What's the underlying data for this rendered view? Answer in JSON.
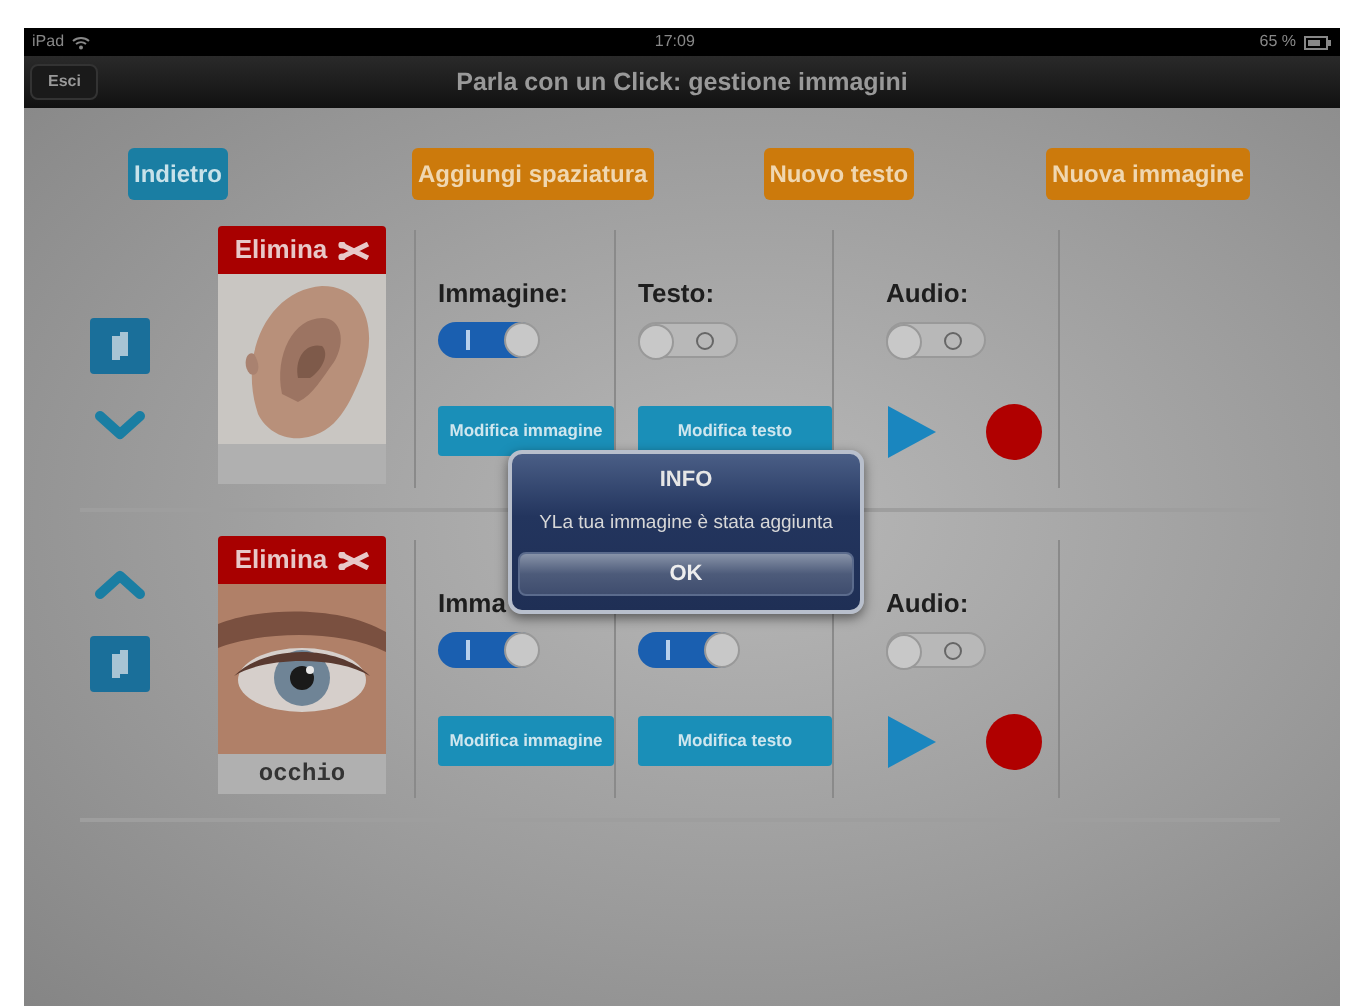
{
  "status_bar": {
    "device": "iPad",
    "time": "17:09",
    "battery": "65 %"
  },
  "nav_bar": {
    "back_button": "Esci",
    "title": "Parla con un Click: gestione immagini"
  },
  "toolbar": [
    {
      "label": "Indietro",
      "kind": "blue"
    },
    {
      "label": "Aggiungi spaziatura",
      "kind": "orange"
    },
    {
      "label": "Nuovo testo",
      "kind": "orange"
    },
    {
      "label": "Nuova immagine",
      "kind": "orange"
    }
  ],
  "items": [
    {
      "controls": [
        {
          "kind": "copy"
        },
        {
          "kind": "down"
        }
      ],
      "delete_label": "Elimina",
      "image_toggle": {
        "label": "Immagine:",
        "on": true
      },
      "image_button": "Modifica immagine",
      "text_toggle": {
        "label": "Testo:",
        "on": false
      },
      "text_button": "Modifica testo",
      "audio_toggle": {
        "label": "Audio:",
        "on": false
      }
    },
    {
      "controls": [
        {
          "kind": "up"
        },
        {
          "kind": "copy"
        }
      ],
      "delete_label": "Elimina",
      "caption": "occhio",
      "image_toggle": {
        "label": "Imma",
        "on": true
      },
      "image_button": "Modifica immagine",
      "text_toggle": {
        "on": true
      },
      "text_button": "Modifica testo",
      "audio_toggle": {
        "label": "Audio:",
        "on": false
      }
    }
  ],
  "dialog": {
    "title": "INFO",
    "message": "YLa tua immagine è stata aggiunta",
    "button": "OK"
  }
}
